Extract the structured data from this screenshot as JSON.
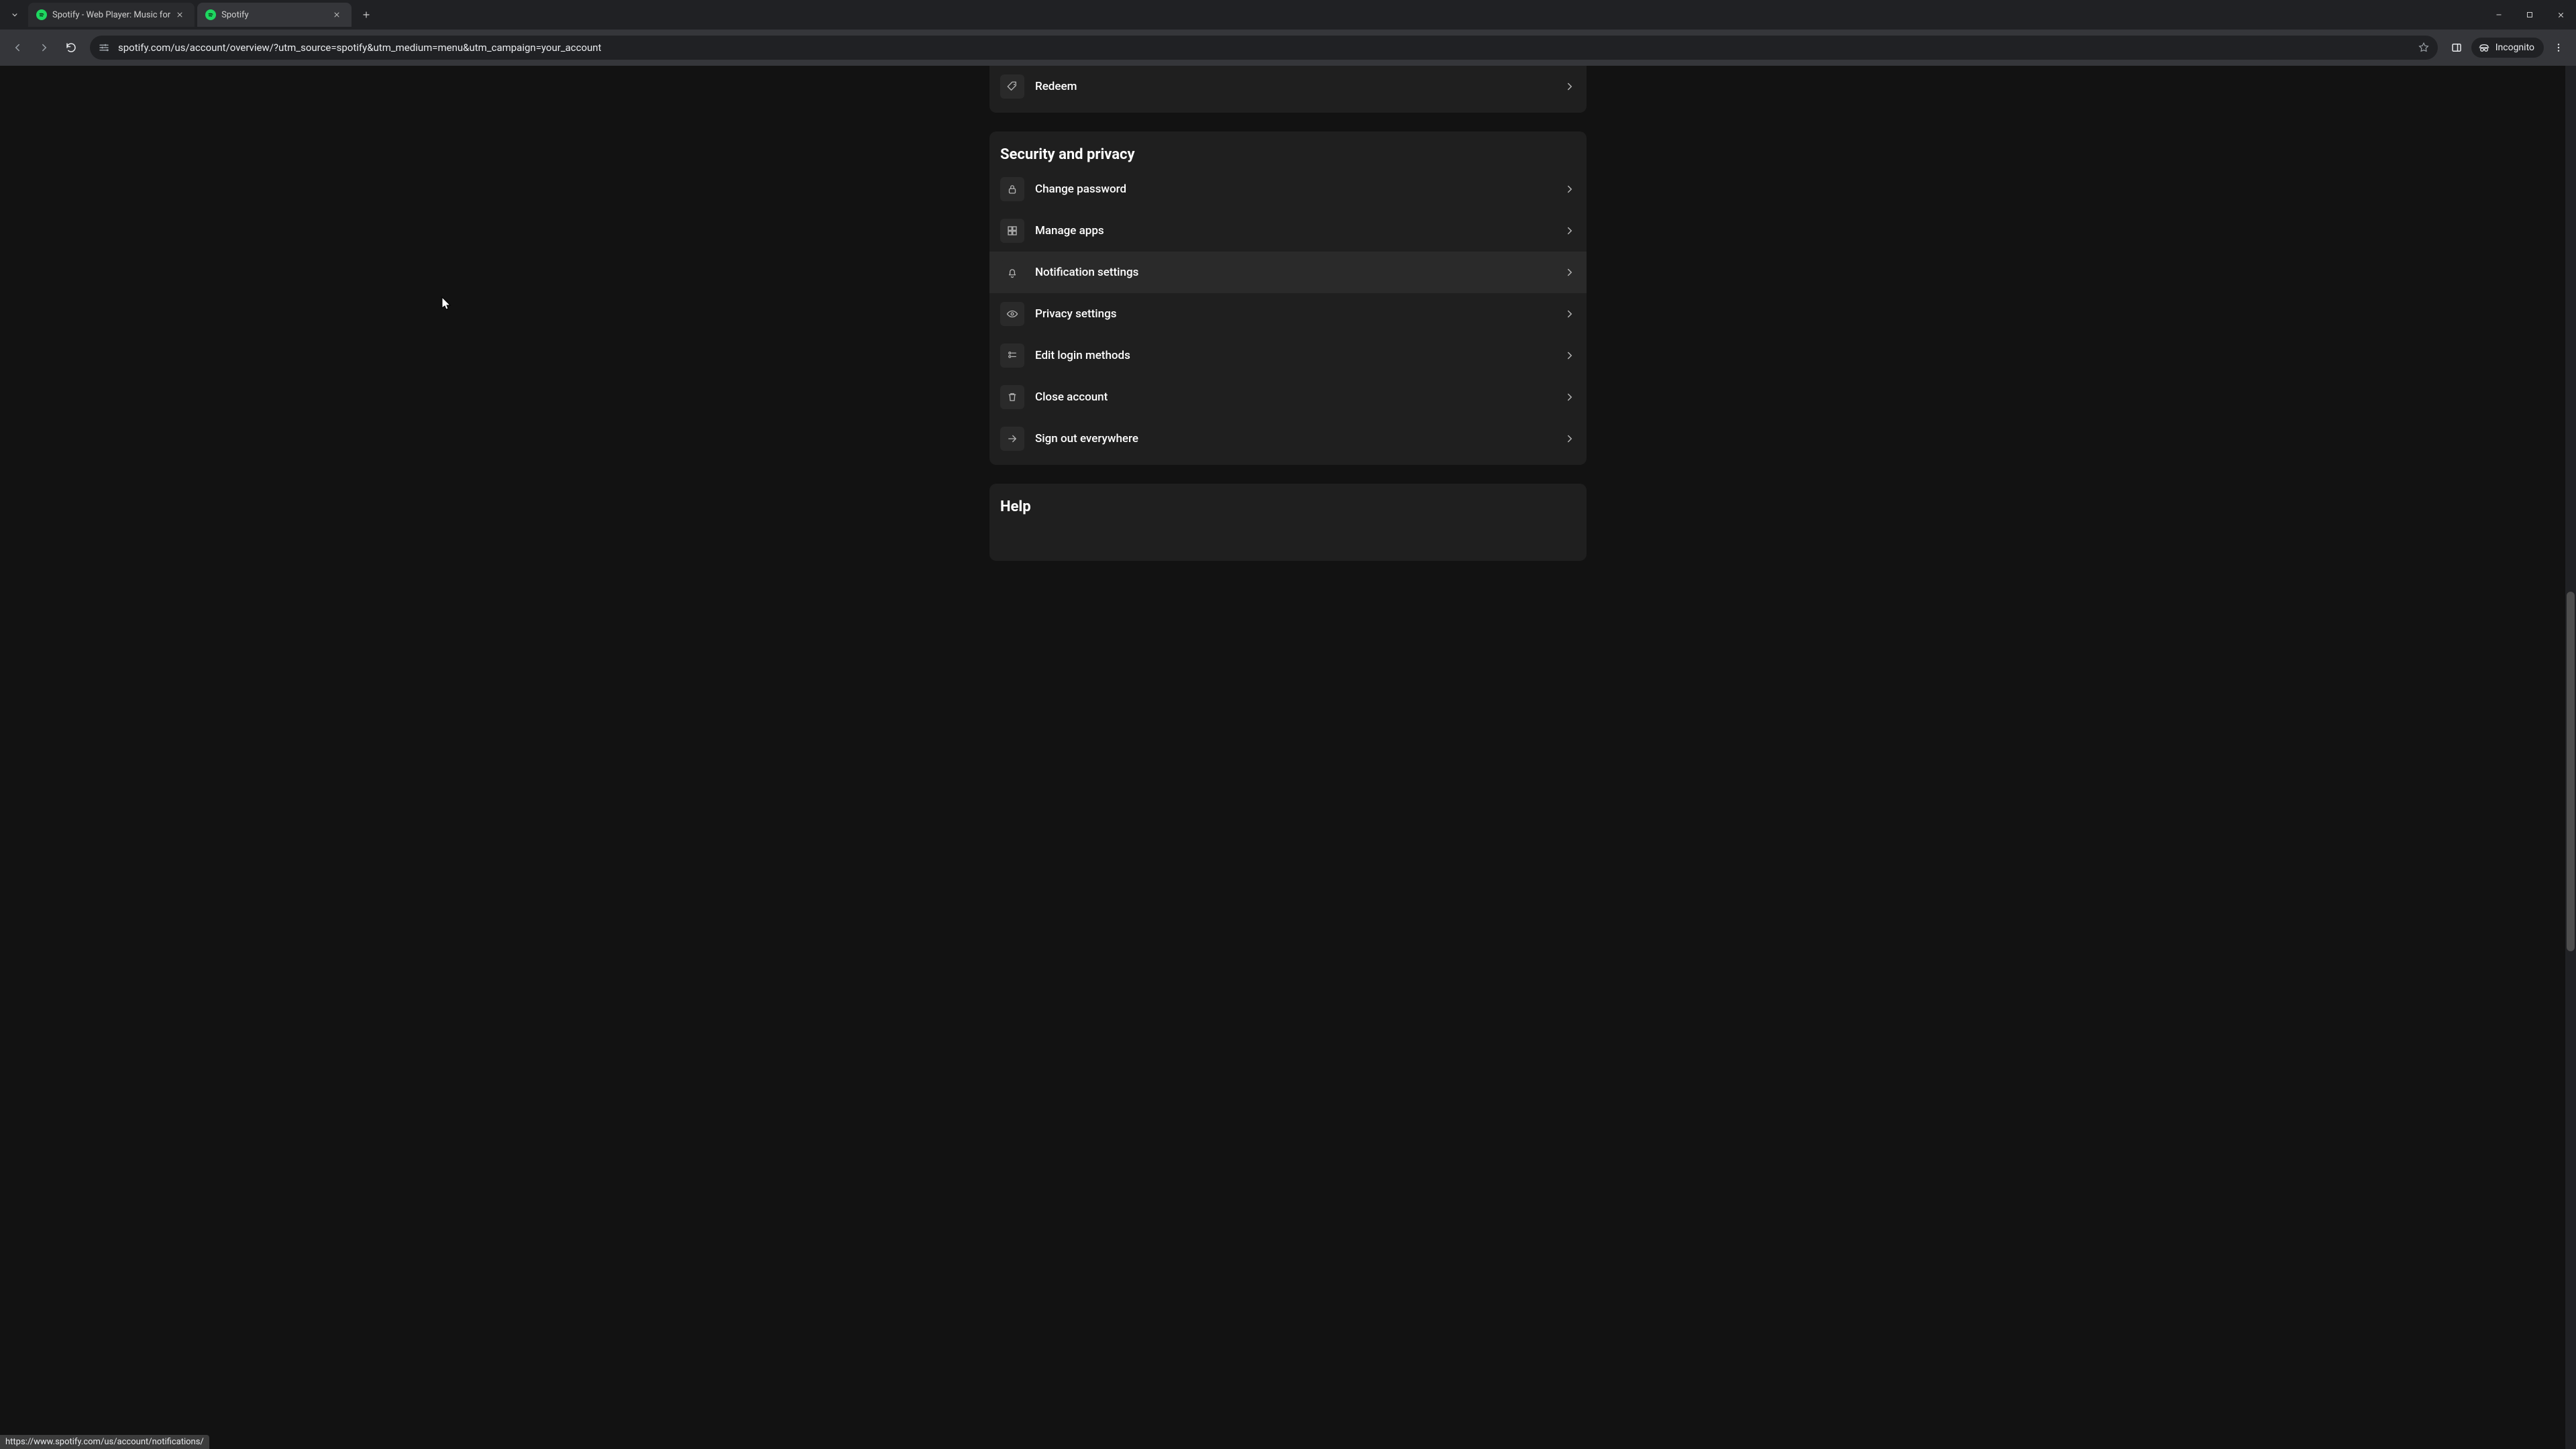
{
  "browser": {
    "tabs": [
      {
        "title": "Spotify - Web Player: Music for"
      },
      {
        "title": "Spotify"
      }
    ],
    "url": "spotify.com/us/account/overview/?utm_source=spotify&utm_medium=menu&utm_campaign=your_account",
    "incognito_label": "Incognito"
  },
  "page": {
    "redeem_label": "Redeem",
    "security_section_title": "Security and privacy",
    "security_items": {
      "change_password": "Change password",
      "manage_apps": "Manage apps",
      "notification_settings": "Notification settings",
      "privacy_settings": "Privacy settings",
      "edit_login_methods": "Edit login methods",
      "close_account": "Close account",
      "sign_out_everywhere": "Sign out everywhere"
    },
    "help_section_title": "Help"
  },
  "status_bar_url": "https://www.spotify.com/us/account/notifications/"
}
